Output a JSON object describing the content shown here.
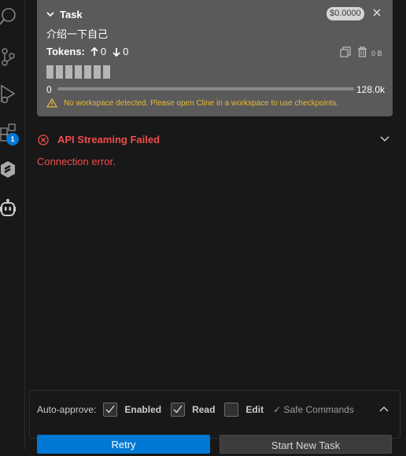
{
  "activity_bar": {
    "extensions_badge": "1"
  },
  "task": {
    "title": "Task",
    "cost": "$0.0000",
    "text": "介绍一下自己",
    "tokens_label": "Tokens:",
    "tokens_in": "0",
    "tokens_out": "0",
    "size": "0 B",
    "context_min": "0",
    "context_max": "128.0k",
    "context_used_fraction": 0.0,
    "warning": "No workspace detected. Please open Cline in a workspace to use checkpoints."
  },
  "error": {
    "title": "API Streaming Failed",
    "message": "Connection error."
  },
  "auto_approve": {
    "label": "Auto-approve:",
    "options": [
      {
        "label": "Enabled",
        "checked": true
      },
      {
        "label": "Read",
        "checked": true
      },
      {
        "label": "Edit",
        "checked": false
      }
    ],
    "safe_commands": "✓ Safe Commands"
  },
  "buttons": {
    "retry": "Retry",
    "start_new_task": "Start New Task"
  },
  "colors": {
    "accent": "#0078d4",
    "error": "#f14c4c",
    "warning": "#e8b83c",
    "task_bg": "#5a5a5a"
  }
}
